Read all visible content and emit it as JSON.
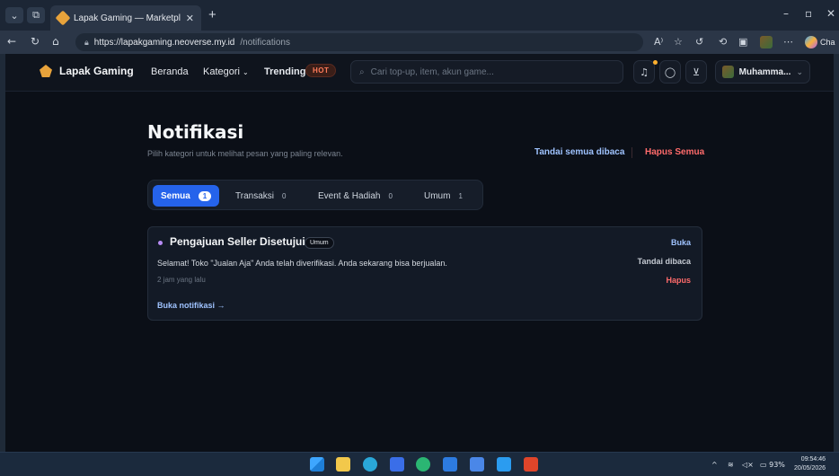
{
  "browser": {
    "tab_title": "Lapak Gaming — Marketplace Gar",
    "url_domain": "https://lapakgaming.neoverse.my.id",
    "url_path": "/notifications",
    "copilot_label": "Cha",
    "icons": [
      "back-icon",
      "refresh-icon",
      "home-icon",
      "lock-icon",
      "read-aloud-icon",
      "favorite-icon",
      "collections-icon",
      "history-icon",
      "more-icon"
    ]
  },
  "header": {
    "brand": "Lapak Gaming",
    "nav_home": "Beranda",
    "nav_category": "Kategori",
    "nav_trending": "Trending",
    "hot_badge": "HOT",
    "search_placeholder": "Cari top-up, item, akun game...",
    "user_name": "Muhamma..."
  },
  "page": {
    "title": "Notifikasi",
    "subtitle": "Pilih kategori untuk melihat pesan yang paling relevan.",
    "mark_all_read": "Tandai semua dibaca",
    "delete_all": "Hapus Semua"
  },
  "tabs": [
    {
      "label": "Semua",
      "count": "1"
    },
    {
      "label": "Transaksi",
      "count": "0"
    },
    {
      "label": "Event & Hadiah",
      "count": "0"
    },
    {
      "label": "Umum",
      "count": "1"
    }
  ],
  "notification": {
    "title": "Pengajuan Seller Disetujui",
    "category": "Umum",
    "message": "Selamat! Toko \"Jualan Aja\" Anda telah diverifikasi. Anda sekarang bisa berjualan.",
    "time": "2 jam yang lalu",
    "open_link": "Buka notifikasi →",
    "action_open": "Buka",
    "action_mark_read": "Tandai dibaca",
    "action_delete": "Hapus"
  },
  "taskbar": {
    "battery": "93%",
    "time": "09:54:46",
    "date": "20/05/2026"
  },
  "colors": {
    "accent": "#2563eb",
    "danger": "#ff6b6b",
    "link": "#9fc3ff",
    "background": "#0b0f17"
  }
}
